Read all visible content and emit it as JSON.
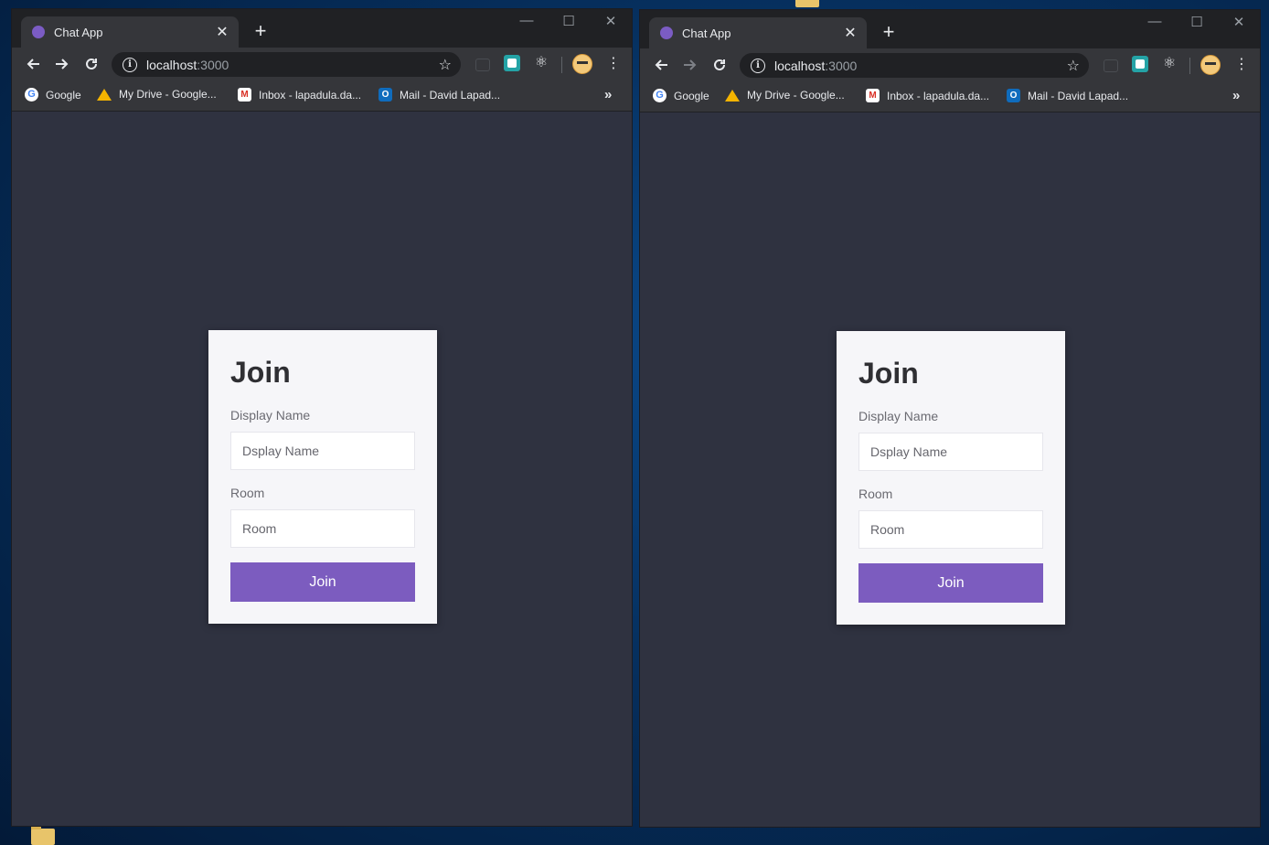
{
  "browser": {
    "tab_title": "Chat App",
    "tab_close": "✕",
    "new_tab": "+",
    "window_controls": {
      "minimize": "—",
      "maximize": "☐",
      "close": "✕"
    },
    "url_host": "localhost",
    "url_port": ":3000",
    "more_menu": "⋮",
    "bookmarks": [
      {
        "label": "Google",
        "icon": "google-icon"
      },
      {
        "label": "My Drive - Google...",
        "icon": "google-drive-icon"
      },
      {
        "label": "Inbox - lapadula.da...",
        "icon": "gmail-icon"
      },
      {
        "label": "Mail - David Lapad...",
        "icon": "outlook-icon"
      }
    ],
    "bookmarks_more": "»"
  },
  "join_form": {
    "title": "Join",
    "display_name_label": "Display Name",
    "display_name_placeholder": "Dsplay Name",
    "room_label": "Room",
    "room_placeholder": "Room",
    "join_button": "Join"
  },
  "colors": {
    "accent": "#7c5cbf",
    "page_bg": "#2f3240",
    "card_bg": "#f6f6f9",
    "favicon": "#7b5cc4"
  }
}
